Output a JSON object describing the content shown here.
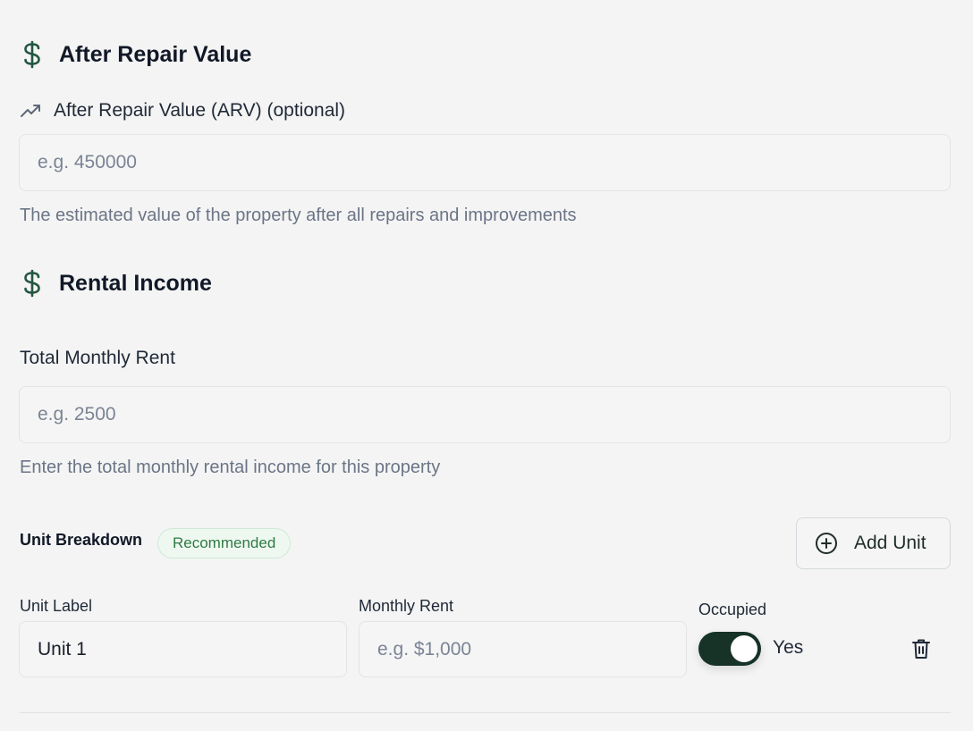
{
  "arv_section": {
    "title": "After Repair Value",
    "icon": "dollar-icon",
    "field_label": "After Repair Value (ARV) (optional)",
    "field_icon": "trending-up-icon",
    "input_placeholder": "e.g. 450000",
    "input_value": "",
    "helper": "The estimated value of the property after all repairs and improvements"
  },
  "rental_section": {
    "title": "Rental Income",
    "icon": "dollar-icon",
    "field_label": "Total Monthly Rent",
    "input_placeholder": "e.g. 2500",
    "input_value": "",
    "helper": "Enter the total monthly rental income for this property"
  },
  "unit_breakdown": {
    "title": "Unit Breakdown",
    "badge": "Recommended",
    "add_button": "Add Unit",
    "columns": {
      "label": "Unit Label",
      "rent": "Monthly Rent",
      "occupied": "Occupied"
    },
    "units": [
      {
        "label_value": "Unit 1",
        "rent_placeholder": "e.g. $1,000",
        "rent_value": "",
        "occupied": true,
        "occupied_text": "Yes"
      }
    ]
  },
  "colors": {
    "accent": "#173227",
    "badge_text": "#2f7a45",
    "badge_bg": "#eef8f0",
    "helper_text": "#6b7586"
  }
}
